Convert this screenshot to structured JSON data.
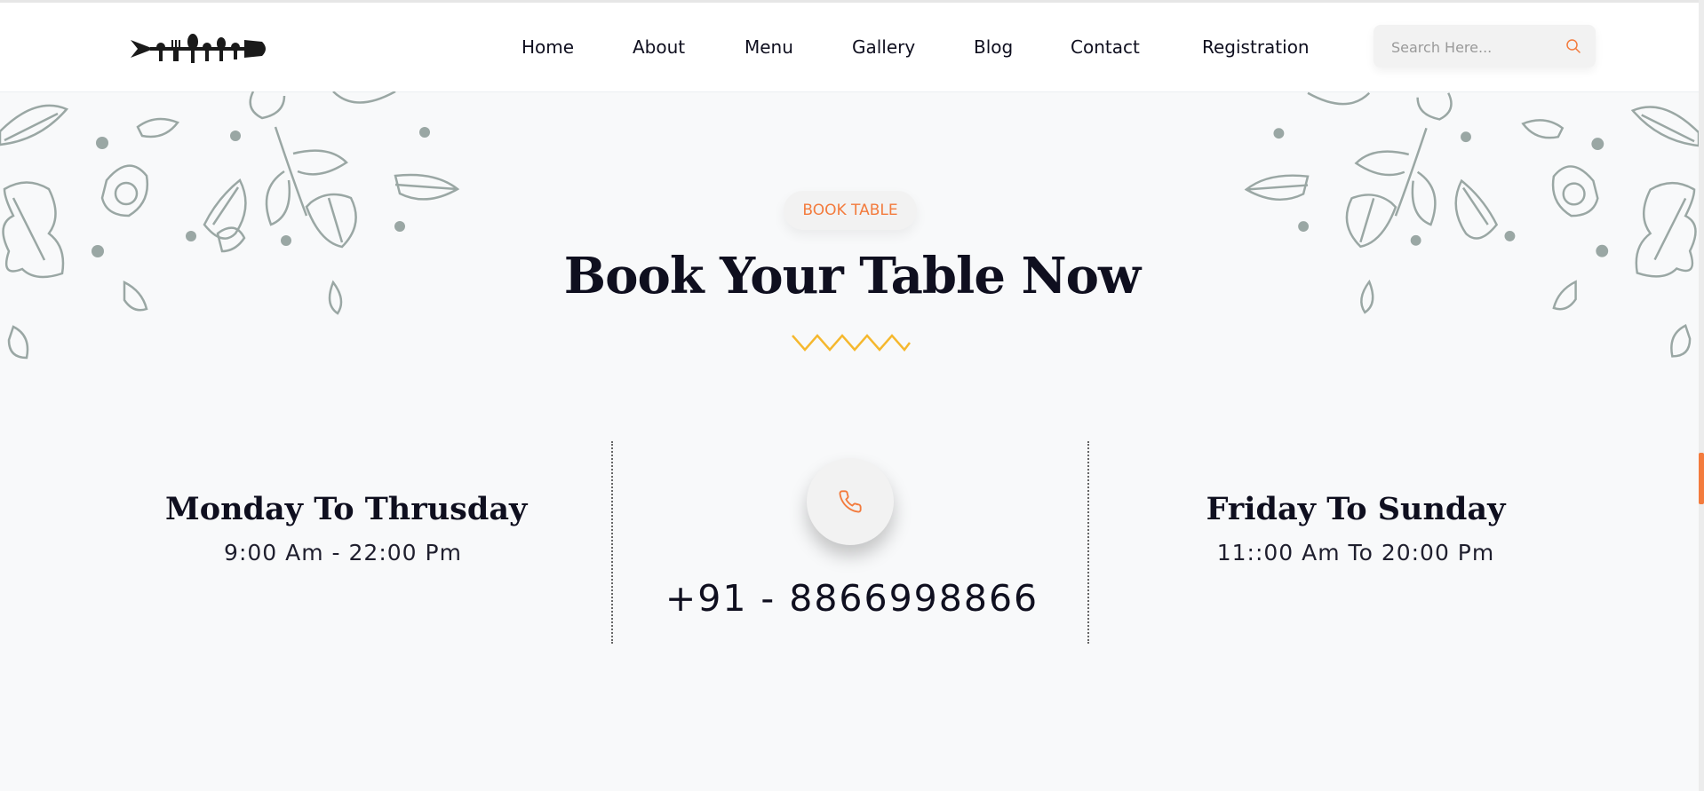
{
  "nav": {
    "items": [
      {
        "label": "Home"
      },
      {
        "label": "About"
      },
      {
        "label": "Menu"
      },
      {
        "label": "Gallery"
      },
      {
        "label": "Blog"
      },
      {
        "label": "Contact"
      },
      {
        "label": "Registration"
      }
    ]
  },
  "search": {
    "placeholder": "Search Here...",
    "value": ""
  },
  "section": {
    "badge": "BOOK TABLE",
    "title": "Book Your Table Now"
  },
  "hours": {
    "weekday": {
      "title": "Monday To Thrusday",
      "time": "9:00 Am - 22:00 Pm"
    },
    "weekend": {
      "title": "Friday To Sunday",
      "time": "11::00 Am To 20:00 Pm"
    }
  },
  "contact": {
    "phone": "+91 - 8866998866"
  },
  "colors": {
    "accent": "#f37b3d",
    "zigzag": "#f5b82e",
    "text_dark": "#0f0f1f",
    "decor": "#9aa7a4"
  },
  "icons": {
    "search": "search-icon",
    "phone": "phone-icon",
    "logo": "utensils-logo"
  }
}
